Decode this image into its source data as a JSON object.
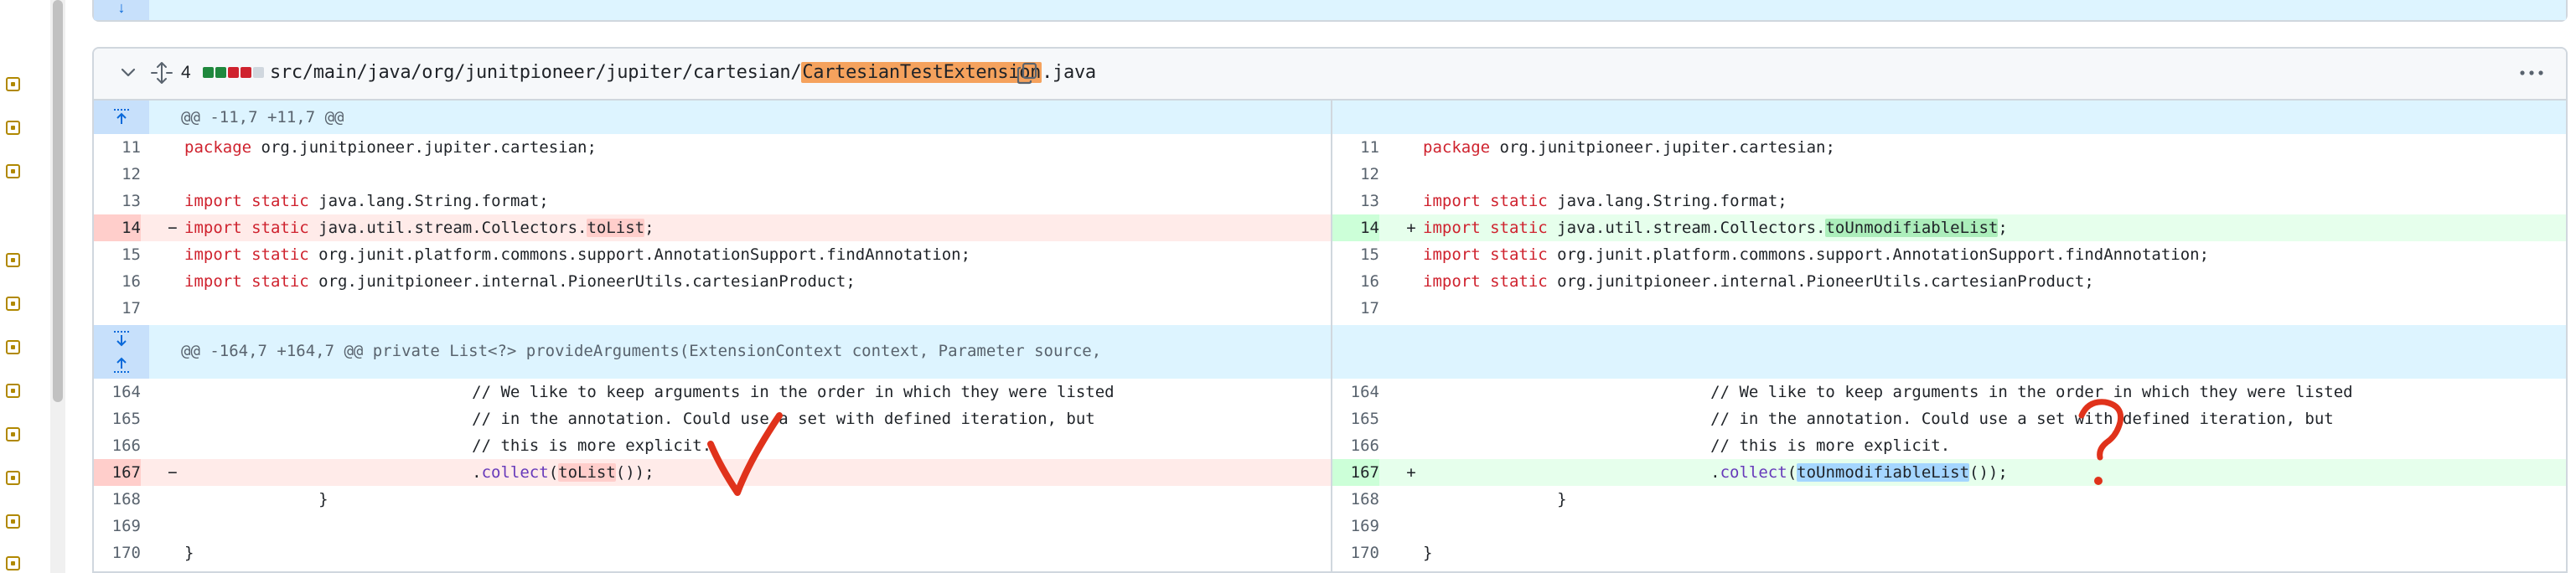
{
  "file": {
    "changes": "4",
    "path_prefix": "src/main/java/org/junitpioneer/jupiter/cartesian/",
    "path_highlight": "CartesianTestExtension",
    "path_suffix": ".java",
    "diffstat": [
      "add",
      "add",
      "del",
      "del",
      "neu"
    ]
  },
  "hunks": [
    {
      "header": "@@ -11,7 +11,7 @@"
    },
    {
      "header": "@@ -164,7 +164,7 @@ private List<?> provideArguments(ExtensionContext context, Parameter source,"
    }
  ],
  "lines_hunk1": {
    "left": [
      {
        "n": "11",
        "t": "ctx",
        "segs": [
          [
            "kw",
            "package"
          ],
          [
            "",
            "org.junitpioneer.jupiter.cartesian;"
          ]
        ]
      },
      {
        "n": "12",
        "t": "ctx",
        "segs": []
      },
      {
        "n": "13",
        "t": "ctx",
        "segs": [
          [
            "kw",
            "import static"
          ],
          [
            "",
            "java.lang.String.format;"
          ]
        ]
      },
      {
        "n": "14",
        "t": "del",
        "segs": [
          [
            "kw",
            "import static"
          ],
          [
            "",
            "java.util.stream.Collectors."
          ],
          [
            "del-word",
            "toList"
          ],
          [
            "",
            ";"
          ]
        ]
      },
      {
        "n": "15",
        "t": "ctx",
        "segs": [
          [
            "kw",
            "import static"
          ],
          [
            "",
            "org.junit.platform.commons.support.AnnotationSupport.findAnnotation;"
          ]
        ]
      },
      {
        "n": "16",
        "t": "ctx",
        "segs": [
          [
            "kw",
            "import static"
          ],
          [
            "",
            "org.junitpioneer.internal.PioneerUtils.cartesianProduct;"
          ]
        ]
      },
      {
        "n": "17",
        "t": "ctx",
        "segs": []
      }
    ],
    "right": [
      {
        "n": "11",
        "t": "ctx",
        "segs": [
          [
            "kw",
            "package"
          ],
          [
            "",
            "org.junitpioneer.jupiter.cartesian;"
          ]
        ]
      },
      {
        "n": "12",
        "t": "ctx",
        "segs": []
      },
      {
        "n": "13",
        "t": "ctx",
        "segs": [
          [
            "kw",
            "import static"
          ],
          [
            "",
            "java.lang.String.format;"
          ]
        ]
      },
      {
        "n": "14",
        "t": "add",
        "segs": [
          [
            "kw",
            "import static"
          ],
          [
            "",
            "java.util.stream.Collectors."
          ],
          [
            "add-word",
            "toUnmodifiableList"
          ],
          [
            "",
            ";"
          ]
        ]
      },
      {
        "n": "15",
        "t": "ctx",
        "segs": [
          [
            "kw",
            "import static"
          ],
          [
            "",
            "org.junit.platform.commons.support.AnnotationSupport.findAnnotation;"
          ]
        ]
      },
      {
        "n": "16",
        "t": "ctx",
        "segs": [
          [
            "kw",
            "import static"
          ],
          [
            "",
            "org.junitpioneer.internal.PioneerUtils.cartesianProduct;"
          ]
        ]
      },
      {
        "n": "17",
        "t": "ctx",
        "segs": []
      }
    ]
  },
  "lines_hunk2": {
    "left": [
      {
        "n": "164",
        "t": "ctx",
        "segs": [
          [
            "",
            "                              // We like to keep arguments in the order in which they were listed"
          ]
        ]
      },
      {
        "n": "165",
        "t": "ctx",
        "segs": [
          [
            "",
            "                              // in the annotation. Could use a set with defined iteration, but"
          ]
        ]
      },
      {
        "n": "166",
        "t": "ctx",
        "segs": [
          [
            "",
            "                              // this is more explicit."
          ]
        ]
      },
      {
        "n": "167",
        "t": "del",
        "segs": [
          [
            "",
            "                              ."
          ],
          [
            "fn",
            "collect"
          ],
          [
            "",
            "("
          ],
          [
            "del-word",
            "toList"
          ],
          [
            "",
            "());"
          ]
        ]
      },
      {
        "n": "168",
        "t": "ctx",
        "segs": [
          [
            "",
            "              }"
          ]
        ]
      },
      {
        "n": "169",
        "t": "ctx",
        "segs": []
      },
      {
        "n": "170",
        "t": "ctx",
        "segs": [
          [
            "",
            "}"
          ]
        ]
      }
    ],
    "right": [
      {
        "n": "164",
        "t": "ctx",
        "segs": [
          [
            "",
            "                              // We like to keep arguments in the order in which they were listed"
          ]
        ]
      },
      {
        "n": "165",
        "t": "ctx",
        "segs": [
          [
            "",
            "                              // in the annotation. Could use a set with defined iteration, but"
          ]
        ]
      },
      {
        "n": "166",
        "t": "ctx",
        "segs": [
          [
            "",
            "                              // this is more explicit."
          ]
        ]
      },
      {
        "n": "167",
        "t": "add",
        "segs": [
          [
            "",
            "                              ."
          ],
          [
            "fn",
            "collect"
          ],
          [
            "",
            "("
          ],
          [
            "sel-word",
            "toUnmodifiableList"
          ],
          [
            "",
            "());"
          ]
        ]
      },
      {
        "n": "168",
        "t": "ctx",
        "segs": [
          [
            "",
            "              }"
          ]
        ]
      },
      {
        "n": "169",
        "t": "ctx",
        "segs": []
      },
      {
        "n": "170",
        "t": "ctx",
        "segs": [
          [
            "",
            "}"
          ]
        ]
      }
    ]
  },
  "marks": {
    "del": "−",
    "add": "+"
  },
  "colors": {
    "annotation": "#e0321b"
  }
}
